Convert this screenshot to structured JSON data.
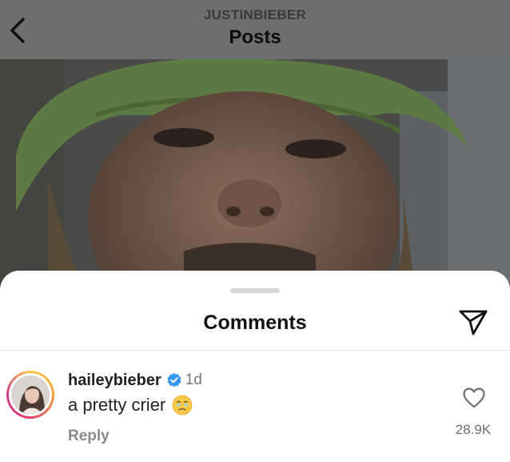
{
  "header": {
    "username": "JUSTINBIEBER",
    "title": "Posts"
  },
  "post": {
    "photo_icon": "post-photo"
  },
  "sheet": {
    "title": "Comments",
    "share_icon": "paper-plane-icon"
  },
  "comment": {
    "avatar_icon": "avatar",
    "username": "haileybieber",
    "verified_icon": "verified-badge-icon",
    "time": "1d",
    "text": "a pretty crier",
    "emoji_icon": "face-holding-back-tears-emoji",
    "reply_label": "Reply",
    "like_icon": "heart-icon",
    "like_count": "28.9K"
  },
  "colors": {
    "accent_verified": "#3897f0",
    "story_ring": "#e4406a",
    "sheet_background": "#ffffff",
    "header_background": "#6e6e6e"
  }
}
